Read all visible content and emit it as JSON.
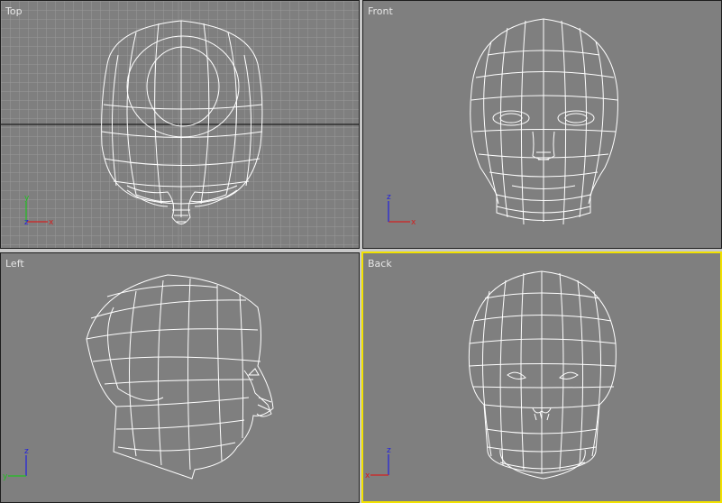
{
  "viewports": {
    "top": {
      "label": "Top",
      "axes": [
        "x",
        "y",
        "z"
      ]
    },
    "front": {
      "label": "Front",
      "axes": [
        "x",
        "z"
      ]
    },
    "left": {
      "label": "Left",
      "axes": [
        "y",
        "z"
      ]
    },
    "back": {
      "label": "Back",
      "axes": [
        "x",
        "z"
      ]
    }
  },
  "colors": {
    "viewport_bg": "#7f7f7f",
    "wireframe": "#ffffff",
    "grid": "#9a9a9a",
    "active_border": "#f2e200",
    "axis_x": "#d22020",
    "axis_y": "#20c020",
    "axis_z": "#2020e0"
  },
  "icons": {
    "axis_tripod": "axis-tripod-icon"
  }
}
